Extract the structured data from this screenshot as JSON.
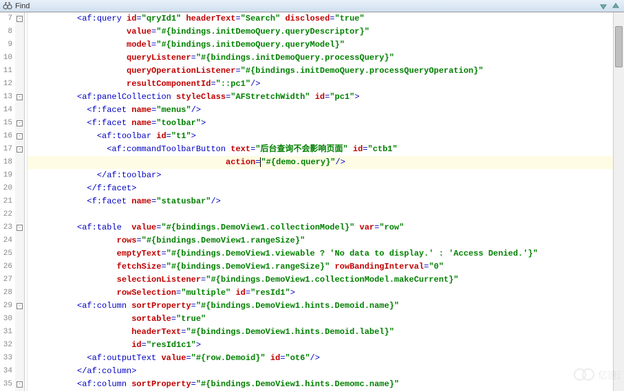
{
  "toolbar": {
    "find_label": "Find"
  },
  "lines": [
    {
      "num": 7,
      "fold": "-",
      "indent": 10,
      "tokens": [
        [
          "punct",
          "<"
        ],
        [
          "tag",
          "af:query"
        ],
        [
          "txt",
          " "
        ],
        [
          "attr",
          "id"
        ],
        [
          "punct",
          "="
        ],
        [
          "val",
          "\"qryId1\""
        ],
        [
          "txt",
          " "
        ],
        [
          "attr",
          "headerText"
        ],
        [
          "punct",
          "="
        ],
        [
          "val",
          "\"Search\""
        ],
        [
          "txt",
          " "
        ],
        [
          "attr",
          "disclosed"
        ],
        [
          "punct",
          "="
        ],
        [
          "val",
          "\"true\""
        ]
      ]
    },
    {
      "num": 8,
      "indent": 20,
      "tokens": [
        [
          "attr",
          "value"
        ],
        [
          "punct",
          "="
        ],
        [
          "val",
          "\"#{bindings.initDemoQuery.queryDescriptor}\""
        ]
      ]
    },
    {
      "num": 9,
      "indent": 20,
      "tokens": [
        [
          "attr",
          "model"
        ],
        [
          "punct",
          "="
        ],
        [
          "val",
          "\"#{bindings.initDemoQuery.queryModel}\""
        ]
      ]
    },
    {
      "num": 10,
      "indent": 20,
      "tokens": [
        [
          "attr",
          "queryListener"
        ],
        [
          "punct",
          "="
        ],
        [
          "val",
          "\"#{bindings.initDemoQuery.processQuery}\""
        ]
      ]
    },
    {
      "num": 11,
      "indent": 20,
      "tokens": [
        [
          "attr",
          "queryOperationListener"
        ],
        [
          "punct",
          "="
        ],
        [
          "val",
          "\"#{bindings.initDemoQuery.processQueryOperation}\""
        ]
      ]
    },
    {
      "num": 12,
      "indent": 20,
      "tokens": [
        [
          "attr",
          "resultComponentId"
        ],
        [
          "punct",
          "="
        ],
        [
          "val",
          "\"::pc1\""
        ],
        [
          "punct",
          "/>"
        ]
      ]
    },
    {
      "num": 13,
      "fold": "-",
      "indent": 10,
      "tokens": [
        [
          "punct",
          "<"
        ],
        [
          "tag",
          "af:panelCollection"
        ],
        [
          "txt",
          " "
        ],
        [
          "attr",
          "styleClass"
        ],
        [
          "punct",
          "="
        ],
        [
          "val",
          "\"AFStretchWidth\""
        ],
        [
          "txt",
          " "
        ],
        [
          "attr",
          "id"
        ],
        [
          "punct",
          "="
        ],
        [
          "val",
          "\"pc1\""
        ],
        [
          "punct",
          ">"
        ]
      ]
    },
    {
      "num": 14,
      "indent": 12,
      "tokens": [
        [
          "punct",
          "<"
        ],
        [
          "tag",
          "f:facet"
        ],
        [
          "txt",
          " "
        ],
        [
          "attr",
          "name"
        ],
        [
          "punct",
          "="
        ],
        [
          "val",
          "\"menus\""
        ],
        [
          "punct",
          "/>"
        ]
      ]
    },
    {
      "num": 15,
      "fold": "-",
      "indent": 12,
      "tokens": [
        [
          "punct",
          "<"
        ],
        [
          "tag",
          "f:facet"
        ],
        [
          "txt",
          " "
        ],
        [
          "attr",
          "name"
        ],
        [
          "punct",
          "="
        ],
        [
          "val",
          "\"toolbar\""
        ],
        [
          "punct",
          ">"
        ]
      ]
    },
    {
      "num": 16,
      "fold": "-",
      "indent": 14,
      "tokens": [
        [
          "punct",
          "<"
        ],
        [
          "tag",
          "af:toolbar"
        ],
        [
          "txt",
          " "
        ],
        [
          "attr",
          "id"
        ],
        [
          "punct",
          "="
        ],
        [
          "val",
          "\"t1\""
        ],
        [
          "punct",
          ">"
        ]
      ]
    },
    {
      "num": 17,
      "fold": "-",
      "indent": 16,
      "tokens": [
        [
          "punct",
          "<"
        ],
        [
          "tag",
          "af:commandToolbarButton"
        ],
        [
          "txt",
          " "
        ],
        [
          "attr",
          "text"
        ],
        [
          "punct",
          "="
        ],
        [
          "val",
          "\"后台查询不会影响页面\""
        ],
        [
          "txt",
          " "
        ],
        [
          "attr",
          "id"
        ],
        [
          "punct",
          "="
        ],
        [
          "val",
          "\"ctb1\""
        ]
      ]
    },
    {
      "num": 18,
      "highlight": true,
      "indent": 40,
      "tokens": [
        [
          "attr",
          "action"
        ],
        [
          "punct",
          "="
        ],
        [
          "cursor",
          ""
        ],
        [
          "val",
          "\"#{demo.query}\""
        ],
        [
          "punct",
          "/>"
        ]
      ]
    },
    {
      "num": 19,
      "indent": 14,
      "tokens": [
        [
          "punct",
          "</"
        ],
        [
          "tag",
          "af:toolbar"
        ],
        [
          "punct",
          ">"
        ]
      ]
    },
    {
      "num": 20,
      "indent": 12,
      "tokens": [
        [
          "punct",
          "</"
        ],
        [
          "tag",
          "f:facet"
        ],
        [
          "punct",
          ">"
        ]
      ]
    },
    {
      "num": 21,
      "indent": 12,
      "tokens": [
        [
          "punct",
          "<"
        ],
        [
          "tag",
          "f:facet"
        ],
        [
          "txt",
          " "
        ],
        [
          "attr",
          "name"
        ],
        [
          "punct",
          "="
        ],
        [
          "val",
          "\"statusbar\""
        ],
        [
          "punct",
          "/>"
        ]
      ]
    },
    {
      "num": 22,
      "indent": 0,
      "tokens": []
    },
    {
      "num": 23,
      "fold": "-",
      "indent": 10,
      "tokens": [
        [
          "punct",
          "<"
        ],
        [
          "tag",
          "af:table"
        ],
        [
          "txt",
          "  "
        ],
        [
          "attr",
          "value"
        ],
        [
          "punct",
          "="
        ],
        [
          "val",
          "\"#{bindings.DemoView1.collectionModel}\""
        ],
        [
          "txt",
          " "
        ],
        [
          "attr",
          "var"
        ],
        [
          "punct",
          "="
        ],
        [
          "val",
          "\"row\""
        ]
      ]
    },
    {
      "num": 24,
      "indent": 18,
      "tokens": [
        [
          "attr",
          "rows"
        ],
        [
          "punct",
          "="
        ],
        [
          "val",
          "\"#{bindings.DemoView1.rangeSize}\""
        ]
      ]
    },
    {
      "num": 25,
      "indent": 18,
      "tokens": [
        [
          "attr",
          "emptyText"
        ],
        [
          "punct",
          "="
        ],
        [
          "val",
          "\"#{bindings.DemoView1.viewable ? 'No data to display.' : 'Access Denied.'}\""
        ]
      ]
    },
    {
      "num": 26,
      "indent": 18,
      "tokens": [
        [
          "attr",
          "fetchSize"
        ],
        [
          "punct",
          "="
        ],
        [
          "val",
          "\"#{bindings.DemoView1.rangeSize}\""
        ],
        [
          "txt",
          " "
        ],
        [
          "attr",
          "rowBandingInterval"
        ],
        [
          "punct",
          "="
        ],
        [
          "val",
          "\"0\""
        ]
      ]
    },
    {
      "num": 27,
      "indent": 18,
      "tokens": [
        [
          "attr",
          "selectionListener"
        ],
        [
          "punct",
          "="
        ],
        [
          "val",
          "\"#{bindings.DemoView1.collectionModel.makeCurrent}\""
        ]
      ]
    },
    {
      "num": 28,
      "indent": 18,
      "tokens": [
        [
          "attr",
          "rowSelection"
        ],
        [
          "punct",
          "="
        ],
        [
          "val",
          "\"multiple\""
        ],
        [
          "txt",
          " "
        ],
        [
          "attr",
          "id"
        ],
        [
          "punct",
          "="
        ],
        [
          "val",
          "\"resId1\""
        ],
        [
          "punct",
          ">"
        ]
      ]
    },
    {
      "num": 29,
      "fold": "-",
      "indent": 10,
      "tokens": [
        [
          "punct",
          "<"
        ],
        [
          "tag",
          "af:column"
        ],
        [
          "txt",
          " "
        ],
        [
          "attr",
          "sortProperty"
        ],
        [
          "punct",
          "="
        ],
        [
          "val",
          "\"#{bindings.DemoView1.hints.Demoid.name}\""
        ]
      ]
    },
    {
      "num": 30,
      "indent": 21,
      "tokens": [
        [
          "attr",
          "sortable"
        ],
        [
          "punct",
          "="
        ],
        [
          "val",
          "\"true\""
        ]
      ]
    },
    {
      "num": 31,
      "indent": 21,
      "tokens": [
        [
          "attr",
          "headerText"
        ],
        [
          "punct",
          "="
        ],
        [
          "val",
          "\"#{bindings.DemoView1.hints.Demoid.label}\""
        ]
      ]
    },
    {
      "num": 32,
      "indent": 21,
      "tokens": [
        [
          "attr",
          "id"
        ],
        [
          "punct",
          "="
        ],
        [
          "val",
          "\"resId1c1\""
        ],
        [
          "punct",
          ">"
        ]
      ]
    },
    {
      "num": 33,
      "indent": 12,
      "tokens": [
        [
          "punct",
          "<"
        ],
        [
          "tag",
          "af:outputText"
        ],
        [
          "txt",
          " "
        ],
        [
          "attr",
          "value"
        ],
        [
          "punct",
          "="
        ],
        [
          "val",
          "\"#{row.Demoid}\""
        ],
        [
          "txt",
          " "
        ],
        [
          "attr",
          "id"
        ],
        [
          "punct",
          "="
        ],
        [
          "val",
          "\"ot6\""
        ],
        [
          "punct",
          "/>"
        ]
      ]
    },
    {
      "num": 34,
      "indent": 10,
      "tokens": [
        [
          "punct",
          "</"
        ],
        [
          "tag",
          "af:column"
        ],
        [
          "punct",
          ">"
        ]
      ]
    },
    {
      "num": 35,
      "fold": "-",
      "indent": 10,
      "tokens": [
        [
          "punct",
          "<"
        ],
        [
          "tag",
          "af:column"
        ],
        [
          "txt",
          " "
        ],
        [
          "attr",
          "sortProperty"
        ],
        [
          "punct",
          "="
        ],
        [
          "val",
          "\"#{bindings.DemoView1.hints.Demomc.name}\""
        ]
      ]
    }
  ],
  "watermark": "亿速云"
}
